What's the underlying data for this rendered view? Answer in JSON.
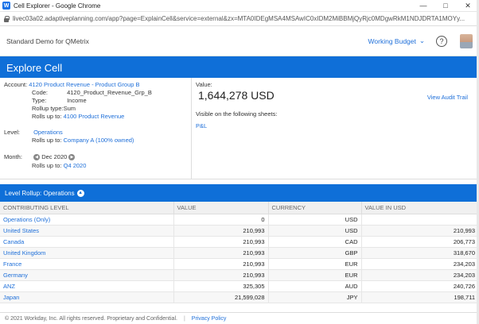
{
  "window": {
    "title": "Cell Explorer - Google Chrome",
    "url": "livec03a02.adaptiveplanning.com/app?page=ExplainCell&service=external&zx=MTA0IDEgMSA4MSAwIC0xIDM2MiBBMjQyRjc0MDgwRkM1NDJDRTA1MOYy..."
  },
  "header": {
    "instance": "Standard Demo for QMetrix",
    "version": "Working Budget",
    "help": "?"
  },
  "banner": {
    "title": "Explore Cell"
  },
  "account": {
    "label": "Account:",
    "value": "4120 Product Revenue - Product Group B",
    "code_label": "Code:",
    "code": "4120_Product_Revenue_Grp_B",
    "type_label": "Type:",
    "type": "Income",
    "rollup_label": "Rollup type:",
    "rollup": "Sum",
    "rollsup_label": "Rolls up to:",
    "rollsup": "4100 Product Revenue"
  },
  "level": {
    "label": "Level:",
    "value": "Operations",
    "rollsup_label": "Rolls up to:",
    "rollsup": "Company A (100% owned)"
  },
  "month": {
    "label": "Month:",
    "value": "Dec 2020",
    "rollsup_label": "Rolls up to:",
    "rollsup": "Q4 2020"
  },
  "cell_value": {
    "label": "Value:",
    "value": "1,644,278  USD",
    "audit": "View Audit Trail",
    "sheets_label": "Visible on the following sheets:",
    "sheet": "P&L"
  },
  "rollup": {
    "label": "Level Rollup: Operations"
  },
  "table": {
    "headers": [
      "CONTRIBUTING LEVEL",
      "VALUE",
      "CURRENCY",
      "VALUE IN USD"
    ],
    "rows": [
      [
        "Operations (Only)",
        "0",
        "USD",
        ""
      ],
      [
        "United States",
        "210,993",
        "USD",
        "210,993"
      ],
      [
        "Canada",
        "210,993",
        "CAD",
        "206,773"
      ],
      [
        "United Kingdom",
        "210,993",
        "GBP",
        "318,670"
      ],
      [
        "France",
        "210,993",
        "EUR",
        "234,203"
      ],
      [
        "Germany",
        "210,993",
        "EUR",
        "234,203"
      ],
      [
        "ANZ",
        "325,305",
        "AUD",
        "240,726"
      ],
      [
        "Japan",
        "21,599,028",
        "JPY",
        "198,711"
      ]
    ]
  },
  "footer": {
    "copyright": "© 2021 Workday, Inc. All rights reserved. Proprietary and Confidential.",
    "privacy": "Privacy Policy"
  },
  "colors": {
    "brand_blue": "#0f6fd8",
    "link": "#1e6fd9"
  }
}
